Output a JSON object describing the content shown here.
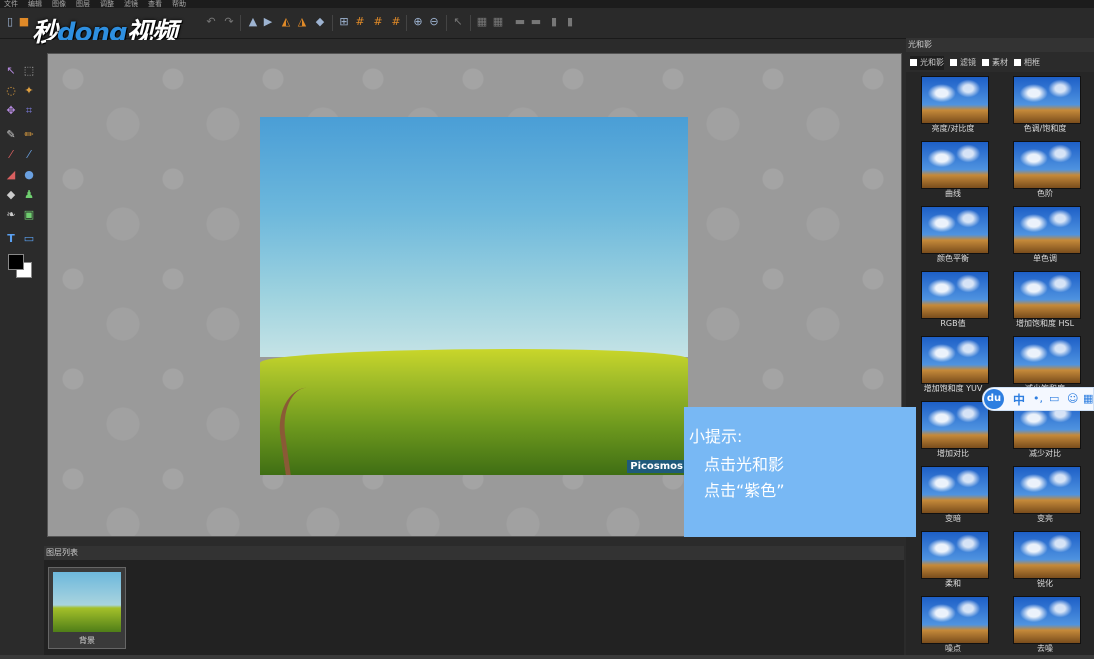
{
  "menu": [
    "文件",
    "编辑",
    "图像",
    "图层",
    "调整",
    "滤镜",
    "查看",
    "帮助"
  ],
  "logo": {
    "part1": "秒",
    "part2": "dong",
    "part3": "视频"
  },
  "watermark": "Picosmos",
  "layers_panel": {
    "title": "图层列表",
    "layer_name": "背景"
  },
  "effects_panel": {
    "title": "光和影",
    "tabs": [
      "光和影",
      "滤镜",
      "素材",
      "相框"
    ],
    "items": [
      "亮度/对比度",
      "色调/饱和度",
      "曲线",
      "色阶",
      "颜色平衡",
      "单色调",
      "RGB值",
      "增加饱和度 HSL",
      "增加饱和度 YUV",
      "减少饱和度",
      "增加对比",
      "减少对比",
      "变暗",
      "变亮",
      "柔和",
      "锐化",
      "噪点",
      "去噪"
    ]
  },
  "hint": {
    "title": "小提示:",
    "line1": "点击光和影",
    "line2": "点击“紫色”"
  },
  "ime": {
    "logo": "du",
    "lang": "中"
  },
  "colors": {
    "hint_bg": "#78b8f4",
    "canvas_bg": "#9a9a9a",
    "app_bg": "#2b2b2b"
  }
}
